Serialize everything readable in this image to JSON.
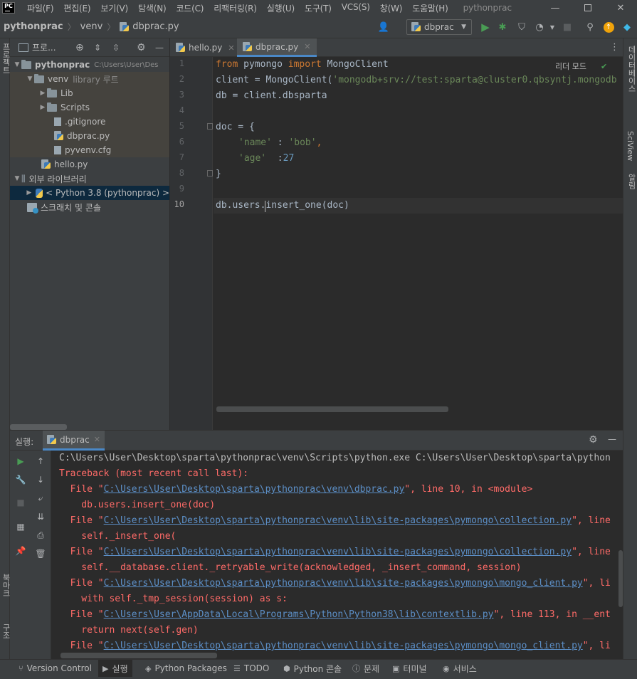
{
  "menu": [
    "파일(F)",
    "편집(E)",
    "보기(V)",
    "탐색(N)",
    "코드(C)",
    "리팩터링(R)",
    "실행(U)",
    "도구(T)",
    "VCS(S)",
    "창(W)",
    "도움말(H)"
  ],
  "window_title": "pythonprac",
  "app_logo": "PC",
  "breadcrumb": {
    "project": "pythonprac",
    "folder": "venv",
    "file": "dbprac.py"
  },
  "run_config": "dbprac",
  "project_panel": {
    "title": "프로...",
    "tree": [
      {
        "label": "pythonprac",
        "hint": "C:\\Users\\User\\Des"
      },
      {
        "label": "venv",
        "hint": "library 루트"
      },
      {
        "label": "Lib"
      },
      {
        "label": "Scripts"
      },
      {
        "label": ".gitignore"
      },
      {
        "label": "dbprac.py"
      },
      {
        "label": "pyvenv.cfg"
      },
      {
        "label": "hello.py"
      },
      {
        "label": "외부 라이브러리"
      },
      {
        "label": "< Python 3.8 (pythonprac) >"
      },
      {
        "label": "스크래치 및 콘솔"
      }
    ]
  },
  "editor": {
    "tabs": [
      "hello.py",
      "dbprac.py"
    ],
    "reader_mode": "리더 모드",
    "line_numbers": [
      "1",
      "2",
      "3",
      "4",
      "5",
      "6",
      "7",
      "8",
      "9",
      "10"
    ],
    "code": {
      "l1": {
        "k1": "from",
        "t1": " pymongo ",
        "k2": "import",
        "t2": " MongoClient"
      },
      "l2": {
        "t1": "client = MongoClient(",
        "s1": "'mongodb+srv://test:sparta@cluster0.qbsyntj.mongodb"
      },
      "l3": "db = client.dbsparta",
      "l5": "doc = {",
      "l6": {
        "s1": "'name'",
        "t1": " : ",
        "s2": "'bob'",
        "t2": ","
      },
      "l7": {
        "s1": "'age'",
        "t1": "  :",
        "n1": "27"
      },
      "l8": "}",
      "l10": "db.users.insert_one(doc)"
    }
  },
  "run_panel": {
    "label": "실행:",
    "tab": "dbprac",
    "console": {
      "cmd": "C:\\Users\\User\\Desktop\\sparta\\pythonprac\\venv\\Scripts\\python.exe C:\\Users\\User\\Desktop\\sparta\\python",
      "traceback": "Traceback (most recent call last):",
      "f1_path": "C:\\Users\\User\\Desktop\\sparta\\pythonprac\\venv\\dbprac.py",
      "f1_tail": "\", line 10, in <module>",
      "f1_code": "    db.users.insert_one(doc)",
      "f2_path": "C:\\Users\\User\\Desktop\\sparta\\pythonprac\\venv\\lib\\site-packages\\pymongo\\collection.py",
      "f2_tail": "\", line",
      "f2_code": "    self._insert_one(",
      "f3_path": "C:\\Users\\User\\Desktop\\sparta\\pythonprac\\venv\\lib\\site-packages\\pymongo\\collection.py",
      "f3_tail": "\", line",
      "f3_code": "    self.__database.client._retryable_write(acknowledged, _insert_command, session)",
      "f4_path": "C:\\Users\\User\\Desktop\\sparta\\pythonprac\\venv\\lib\\site-packages\\pymongo\\mongo_client.py",
      "f4_tail": "\", li",
      "f4_code": "    with self._tmp_session(session) as s:",
      "f5_path": "C:\\Users\\User\\AppData\\Local\\Programs\\Python\\Python38\\lib\\contextlib.py",
      "f5_tail": "\", line 113, in __ent",
      "f5_code": "    return next(self.gen)",
      "f6_path": "C:\\Users\\User\\Desktop\\sparta\\pythonprac\\venv\\lib\\site-packages\\pymongo\\mongo_client.py",
      "f6_tail": "\", li",
      "file_prefix": "  File \""
    }
  },
  "right_strip": [
    "데이터베이스",
    "SciView",
    "알림"
  ],
  "left_strip": [
    "프로젝트",
    "북마크",
    "구조"
  ],
  "status_bar": [
    "Version Control",
    "실행",
    "Python Packages",
    "TODO",
    "Python 콘솔",
    "문제",
    "터미널",
    "서비스"
  ]
}
